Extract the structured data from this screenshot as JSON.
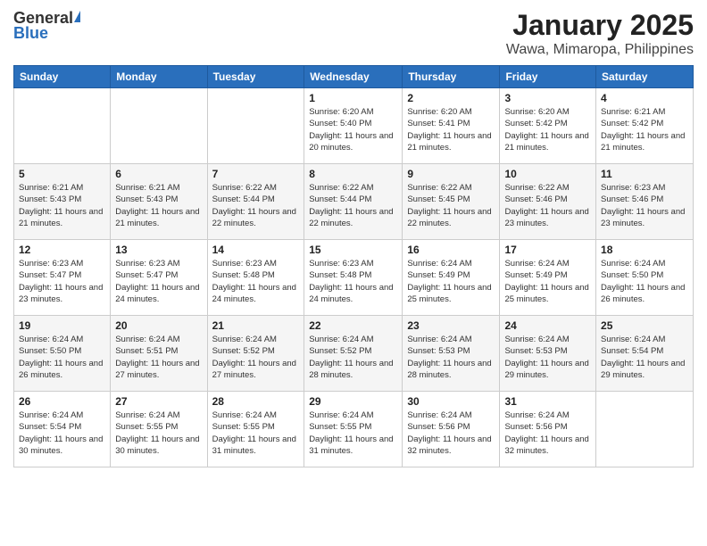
{
  "logo": {
    "general": "General",
    "blue": "Blue"
  },
  "title": "January 2025",
  "subtitle": "Wawa, Mimaropa, Philippines",
  "weekdays": [
    "Sunday",
    "Monday",
    "Tuesday",
    "Wednesday",
    "Thursday",
    "Friday",
    "Saturday"
  ],
  "weeks": [
    [
      {
        "day": "",
        "info": ""
      },
      {
        "day": "",
        "info": ""
      },
      {
        "day": "",
        "info": ""
      },
      {
        "day": "1",
        "info": "Sunrise: 6:20 AM\nSunset: 5:40 PM\nDaylight: 11 hours and 20 minutes."
      },
      {
        "day": "2",
        "info": "Sunrise: 6:20 AM\nSunset: 5:41 PM\nDaylight: 11 hours and 21 minutes."
      },
      {
        "day": "3",
        "info": "Sunrise: 6:20 AM\nSunset: 5:42 PM\nDaylight: 11 hours and 21 minutes."
      },
      {
        "day": "4",
        "info": "Sunrise: 6:21 AM\nSunset: 5:42 PM\nDaylight: 11 hours and 21 minutes."
      }
    ],
    [
      {
        "day": "5",
        "info": "Sunrise: 6:21 AM\nSunset: 5:43 PM\nDaylight: 11 hours and 21 minutes."
      },
      {
        "day": "6",
        "info": "Sunrise: 6:21 AM\nSunset: 5:43 PM\nDaylight: 11 hours and 21 minutes."
      },
      {
        "day": "7",
        "info": "Sunrise: 6:22 AM\nSunset: 5:44 PM\nDaylight: 11 hours and 22 minutes."
      },
      {
        "day": "8",
        "info": "Sunrise: 6:22 AM\nSunset: 5:44 PM\nDaylight: 11 hours and 22 minutes."
      },
      {
        "day": "9",
        "info": "Sunrise: 6:22 AM\nSunset: 5:45 PM\nDaylight: 11 hours and 22 minutes."
      },
      {
        "day": "10",
        "info": "Sunrise: 6:22 AM\nSunset: 5:46 PM\nDaylight: 11 hours and 23 minutes."
      },
      {
        "day": "11",
        "info": "Sunrise: 6:23 AM\nSunset: 5:46 PM\nDaylight: 11 hours and 23 minutes."
      }
    ],
    [
      {
        "day": "12",
        "info": "Sunrise: 6:23 AM\nSunset: 5:47 PM\nDaylight: 11 hours and 23 minutes."
      },
      {
        "day": "13",
        "info": "Sunrise: 6:23 AM\nSunset: 5:47 PM\nDaylight: 11 hours and 24 minutes."
      },
      {
        "day": "14",
        "info": "Sunrise: 6:23 AM\nSunset: 5:48 PM\nDaylight: 11 hours and 24 minutes."
      },
      {
        "day": "15",
        "info": "Sunrise: 6:23 AM\nSunset: 5:48 PM\nDaylight: 11 hours and 24 minutes."
      },
      {
        "day": "16",
        "info": "Sunrise: 6:24 AM\nSunset: 5:49 PM\nDaylight: 11 hours and 25 minutes."
      },
      {
        "day": "17",
        "info": "Sunrise: 6:24 AM\nSunset: 5:49 PM\nDaylight: 11 hours and 25 minutes."
      },
      {
        "day": "18",
        "info": "Sunrise: 6:24 AM\nSunset: 5:50 PM\nDaylight: 11 hours and 26 minutes."
      }
    ],
    [
      {
        "day": "19",
        "info": "Sunrise: 6:24 AM\nSunset: 5:50 PM\nDaylight: 11 hours and 26 minutes."
      },
      {
        "day": "20",
        "info": "Sunrise: 6:24 AM\nSunset: 5:51 PM\nDaylight: 11 hours and 27 minutes."
      },
      {
        "day": "21",
        "info": "Sunrise: 6:24 AM\nSunset: 5:52 PM\nDaylight: 11 hours and 27 minutes."
      },
      {
        "day": "22",
        "info": "Sunrise: 6:24 AM\nSunset: 5:52 PM\nDaylight: 11 hours and 28 minutes."
      },
      {
        "day": "23",
        "info": "Sunrise: 6:24 AM\nSunset: 5:53 PM\nDaylight: 11 hours and 28 minutes."
      },
      {
        "day": "24",
        "info": "Sunrise: 6:24 AM\nSunset: 5:53 PM\nDaylight: 11 hours and 29 minutes."
      },
      {
        "day": "25",
        "info": "Sunrise: 6:24 AM\nSunset: 5:54 PM\nDaylight: 11 hours and 29 minutes."
      }
    ],
    [
      {
        "day": "26",
        "info": "Sunrise: 6:24 AM\nSunset: 5:54 PM\nDaylight: 11 hours and 30 minutes."
      },
      {
        "day": "27",
        "info": "Sunrise: 6:24 AM\nSunset: 5:55 PM\nDaylight: 11 hours and 30 minutes."
      },
      {
        "day": "28",
        "info": "Sunrise: 6:24 AM\nSunset: 5:55 PM\nDaylight: 11 hours and 31 minutes."
      },
      {
        "day": "29",
        "info": "Sunrise: 6:24 AM\nSunset: 5:55 PM\nDaylight: 11 hours and 31 minutes."
      },
      {
        "day": "30",
        "info": "Sunrise: 6:24 AM\nSunset: 5:56 PM\nDaylight: 11 hours and 32 minutes."
      },
      {
        "day": "31",
        "info": "Sunrise: 6:24 AM\nSunset: 5:56 PM\nDaylight: 11 hours and 32 minutes."
      },
      {
        "day": "",
        "info": ""
      }
    ]
  ]
}
